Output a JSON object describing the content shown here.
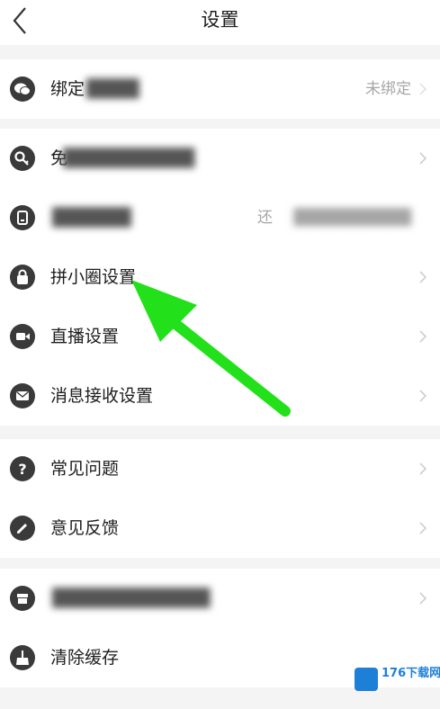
{
  "header": {
    "title": "设置"
  },
  "sections": [
    {
      "rows": [
        {
          "icon": "wechat-icon",
          "label": "绑定",
          "value": "未绑定"
        }
      ]
    },
    {
      "rows": [
        {
          "icon": "key-icon",
          "label": "免",
          "value": ""
        },
        {
          "icon": "phone-icon",
          "label": "",
          "value": "还"
        },
        {
          "icon": "lock-icon",
          "label": "拼小圈设置",
          "value": ""
        },
        {
          "icon": "video-icon",
          "label": "直播设置",
          "value": ""
        },
        {
          "icon": "mail-icon",
          "label": "消息接收设置",
          "value": ""
        }
      ]
    },
    {
      "rows": [
        {
          "icon": "question-icon",
          "label": "常见问题",
          "value": ""
        },
        {
          "icon": "pencil-icon",
          "label": "意见反馈",
          "value": ""
        }
      ]
    },
    {
      "rows": [
        {
          "icon": "store-icon",
          "label": "",
          "value": ""
        },
        {
          "icon": "broom-icon",
          "label": "清除缓存",
          "value": ""
        }
      ]
    }
  ],
  "watermark": {
    "text": "176下载网"
  },
  "colors": {
    "background": "#f4f4f4",
    "annotation_arrow": "#22e01a",
    "watermark": "#1e7fd6"
  }
}
